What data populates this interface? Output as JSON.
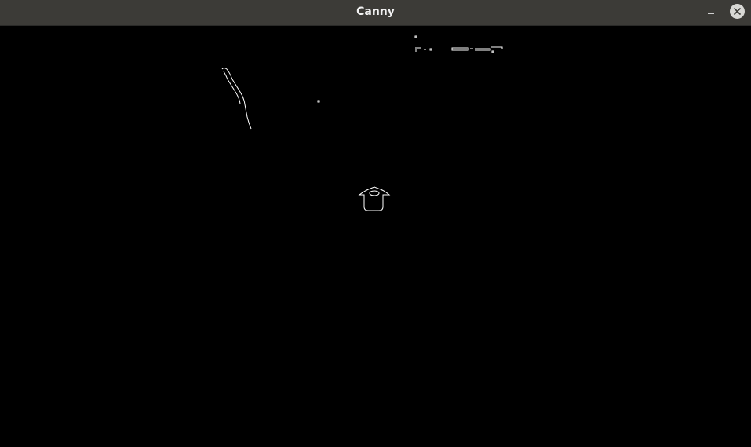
{
  "window": {
    "title": "Canny"
  },
  "colors": {
    "titlebar_bg": "#3c3b37",
    "title_text": "#f2f2f2",
    "canvas_bg": "#000000",
    "edge_stroke": "#ffffff",
    "close_button_bg": "#d8d8d4"
  },
  "icons": {
    "minimize": "minimize-icon",
    "close": "close-icon"
  }
}
